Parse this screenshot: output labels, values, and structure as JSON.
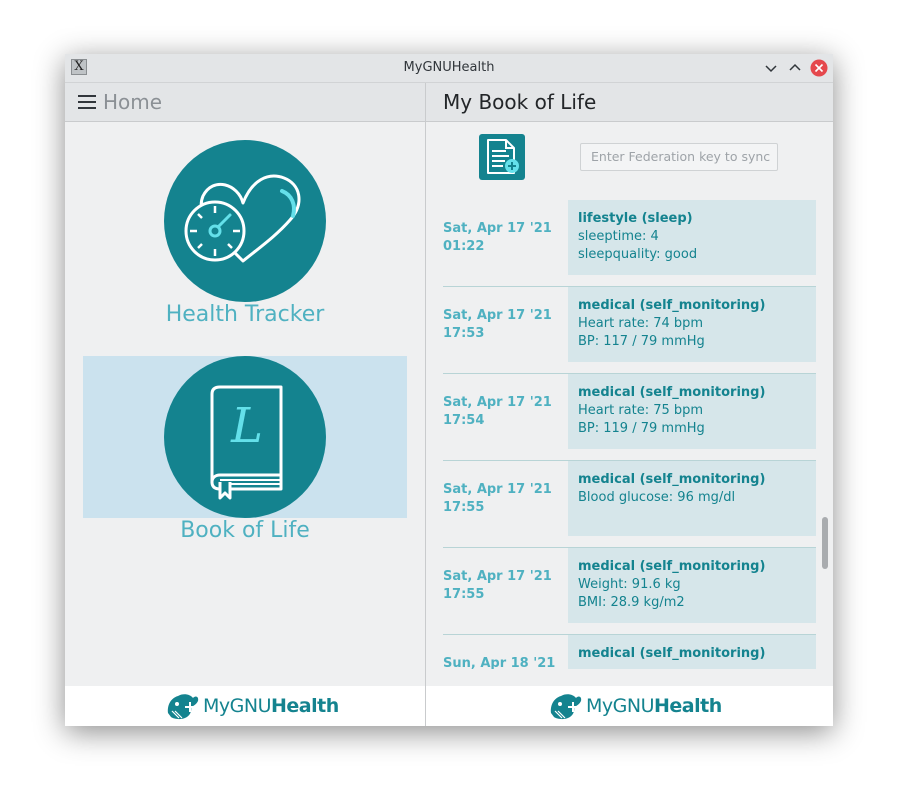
{
  "window": {
    "title": "MyGNUHealth"
  },
  "left": {
    "header_title": "Home",
    "menu": [
      {
        "label": "Health Tracker",
        "icon": "heart-gauge-icon"
      },
      {
        "label": "Book of Life",
        "icon": "book-icon"
      }
    ],
    "footer_logo": {
      "light": "MyGNU",
      "bold": "Health"
    }
  },
  "right": {
    "header_title": "My Book of Life",
    "federation_placeholder": "Enter Federation key to sync",
    "entries": [
      {
        "date": "Sat, Apr 17 '21",
        "time": "01:22",
        "title": "lifestyle (sleep)",
        "lines": [
          "sleeptime: 4",
          "sleepquality: good"
        ]
      },
      {
        "date": "Sat, Apr 17 '21",
        "time": "17:53",
        "title": "medical (self_monitoring)",
        "lines": [
          "Heart rate: 74 bpm",
          "BP: 117 / 79 mmHg"
        ]
      },
      {
        "date": "Sat, Apr 17 '21",
        "time": "17:54",
        "title": "medical (self_monitoring)",
        "lines": [
          "Heart rate: 75 bpm",
          "BP: 119 / 79 mmHg"
        ]
      },
      {
        "date": "Sat, Apr 17 '21",
        "time": "17:55",
        "title": "medical (self_monitoring)",
        "lines": [
          "Blood glucose: 96 mg/dl",
          ""
        ]
      },
      {
        "date": "Sat, Apr 17 '21",
        "time": "17:55",
        "title": "medical (self_monitoring)",
        "lines": [
          "Weight: 91.6 kg",
          "BMI: 28.9 kg/m2"
        ]
      },
      {
        "date": "Sun, Apr 18 '21",
        "time": "",
        "title": "medical (self_monitoring)",
        "lines": [
          "",
          ""
        ]
      }
    ],
    "footer_logo": {
      "light": "MyGNU",
      "bold": "Health"
    }
  },
  "colors": {
    "teal": "#14838f",
    "light_teal": "#4fb1c1",
    "card": "#d6e6ea",
    "highlight": "#cbe2ee"
  }
}
